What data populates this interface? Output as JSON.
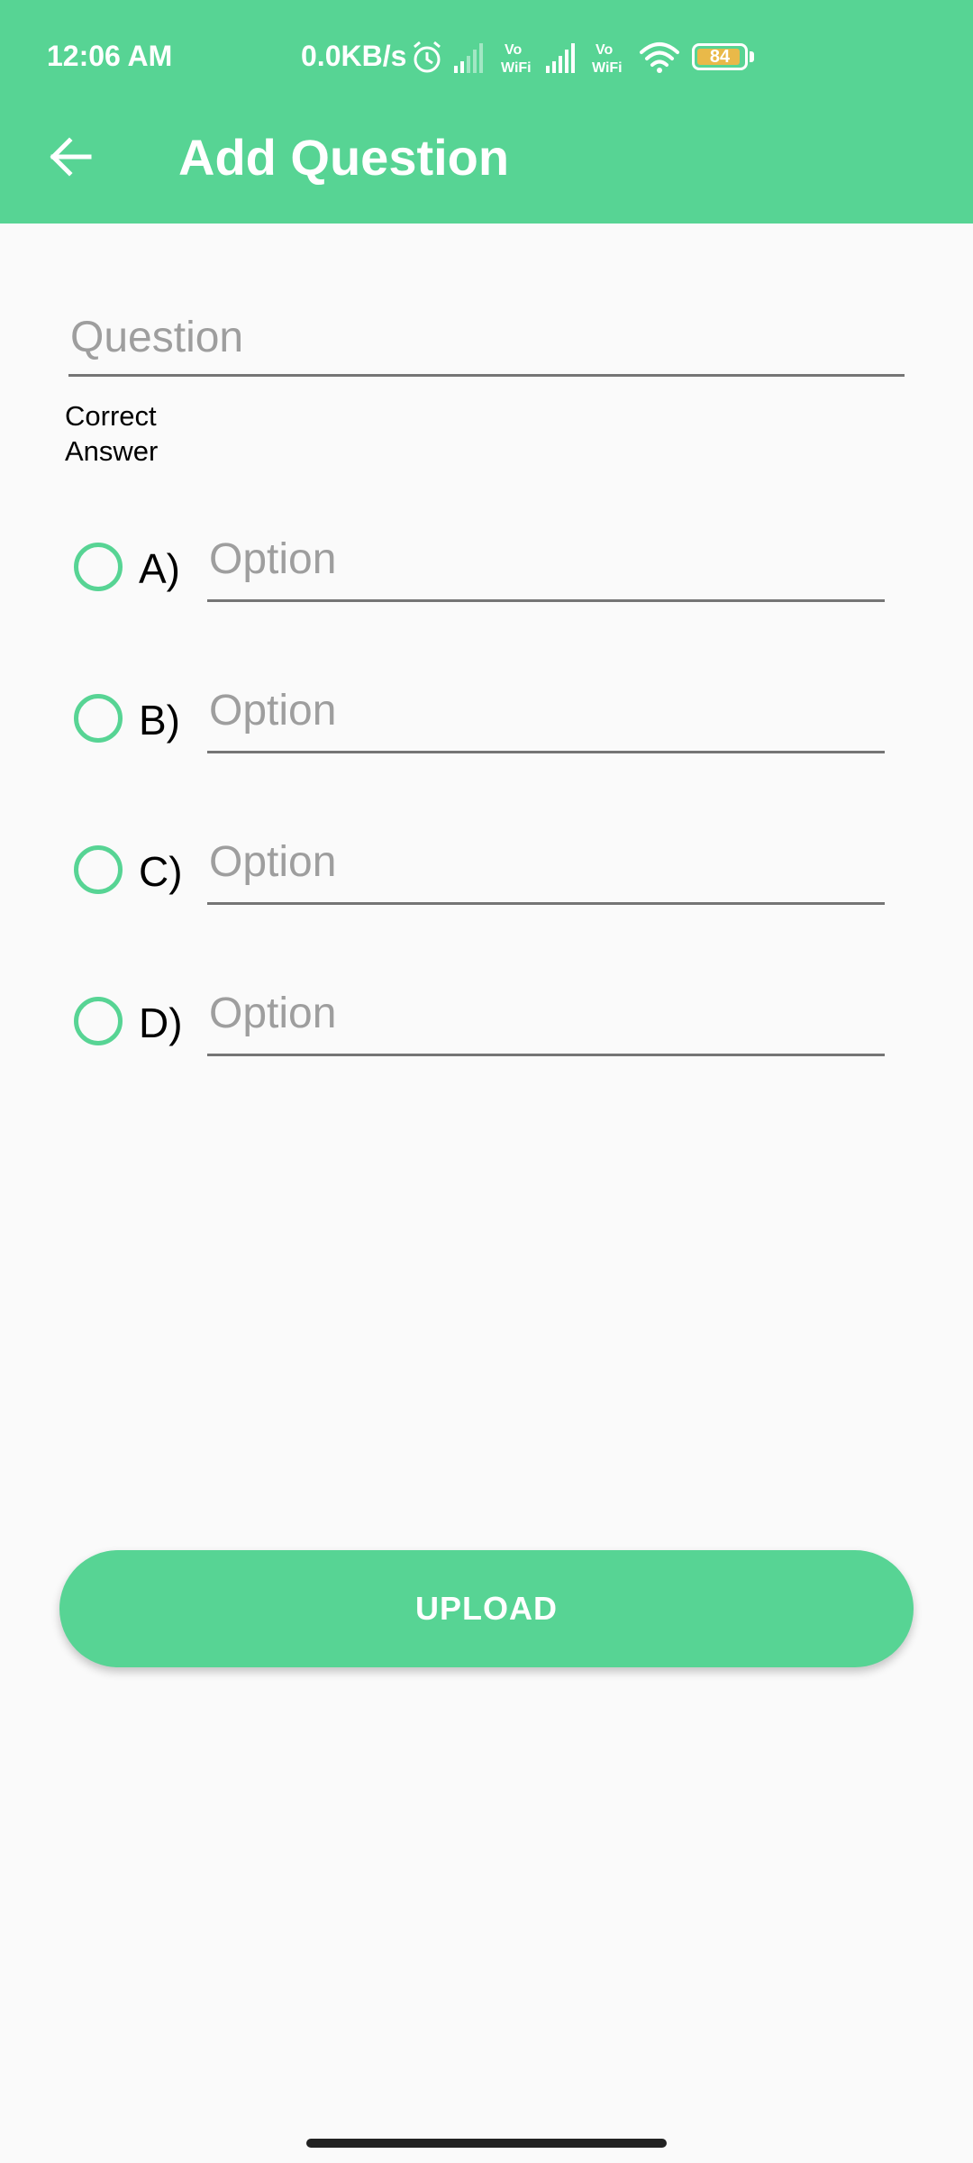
{
  "status_bar": {
    "time": "12:06 AM",
    "network_speed": "0.0KB/s",
    "battery_level": "84",
    "icons": [
      "alarm-icon",
      "signal-1-icon",
      "vowifi-1-icon",
      "signal-2-icon",
      "vowifi-2-icon",
      "wifi-icon",
      "battery-icon"
    ]
  },
  "app_bar": {
    "back_icon": "arrow-left-icon",
    "title": "Add Question"
  },
  "form": {
    "question_placeholder": "Question",
    "question_value": "",
    "correct_answer_label": "Correct Answer",
    "options": [
      {
        "letter": "A)",
        "placeholder": "Option",
        "value": "",
        "selected": false
      },
      {
        "letter": "B)",
        "placeholder": "Option",
        "value": "",
        "selected": false
      },
      {
        "letter": "C)",
        "placeholder": "Option",
        "value": "",
        "selected": false
      },
      {
        "letter": "D)",
        "placeholder": "Option",
        "value": "",
        "selected": false
      }
    ],
    "upload_label": "UPLOAD"
  },
  "colors": {
    "accent": "#57d494",
    "background": "#fafafa",
    "battery": "#e9b949"
  }
}
